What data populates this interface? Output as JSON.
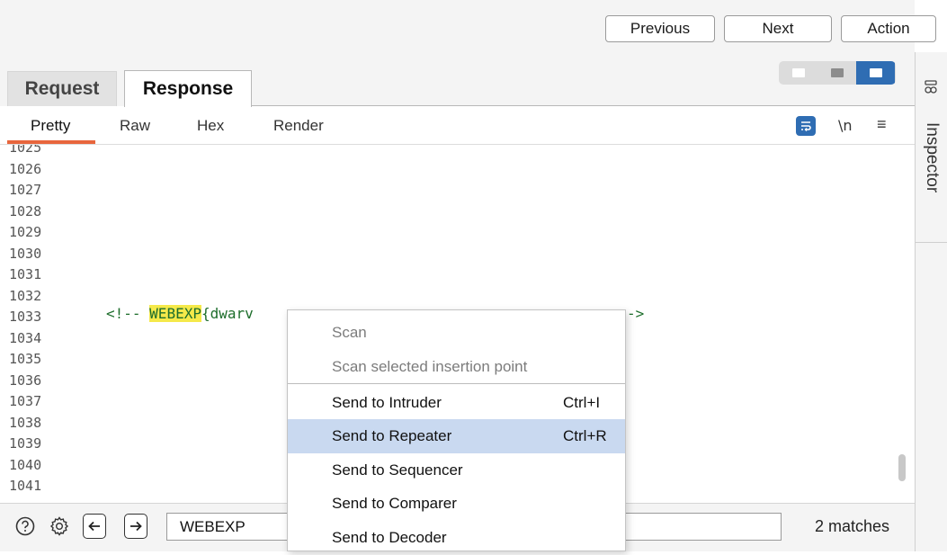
{
  "toolbar": {
    "previous_label": "Previous",
    "next_label": "Next",
    "action_label": "Action"
  },
  "tabs": [
    {
      "label": "Request",
      "active": false
    },
    {
      "label": "Response",
      "active": true
    }
  ],
  "layout_toggle": {
    "selected_index": 2,
    "accent": "#2f6db3"
  },
  "subtabs": [
    {
      "label": "Pretty",
      "active": true
    },
    {
      "label": "Raw"
    },
    {
      "label": "Hex"
    },
    {
      "label": "Render"
    }
  ],
  "editor_tools": {
    "wrap_icon": "word-wrap-icon",
    "newline_label": "\\n",
    "menu_icon": "hamburger-menu-icon"
  },
  "inspector": {
    "label": "Inspector",
    "icon": "inspector-panel-icon"
  },
  "editor": {
    "line_numbers": [
      "1025",
      "1026",
      "1027",
      "1028",
      "1029",
      "1030",
      "1031",
      "1032",
      "1033",
      "1034",
      "1035",
      "1036",
      "1037",
      "1038",
      "1039",
      "1040",
      "1041"
    ],
    "code_prefix": "<!-- ",
    "code_highlight": "WEBEXP",
    "code_visible": "{dwarv",
    "code_tail": "->",
    "highlight_color": "#f5e94a"
  },
  "search": {
    "value": "WEBEXP",
    "matches_text": "2 matches"
  },
  "context_menu": {
    "items": [
      {
        "label": "Scan",
        "shortcut": "",
        "disabled": true
      },
      {
        "label": "Scan selected insertion point",
        "shortcut": "",
        "disabled": true
      },
      {
        "label": "Send to Intruder",
        "shortcut": "Ctrl+I",
        "disabled": false
      },
      {
        "label": "Send to Repeater",
        "shortcut": "Ctrl+R",
        "disabled": false,
        "highlighted": true
      },
      {
        "label": "Send to Sequencer",
        "shortcut": "",
        "disabled": false
      },
      {
        "label": "Send to Comparer",
        "shortcut": "",
        "disabled": false
      },
      {
        "label": "Send to Decoder",
        "shortcut": "",
        "disabled": false
      }
    ],
    "hover_color": "#c9d9f0"
  },
  "accent_tab_underline": "#e8663d"
}
